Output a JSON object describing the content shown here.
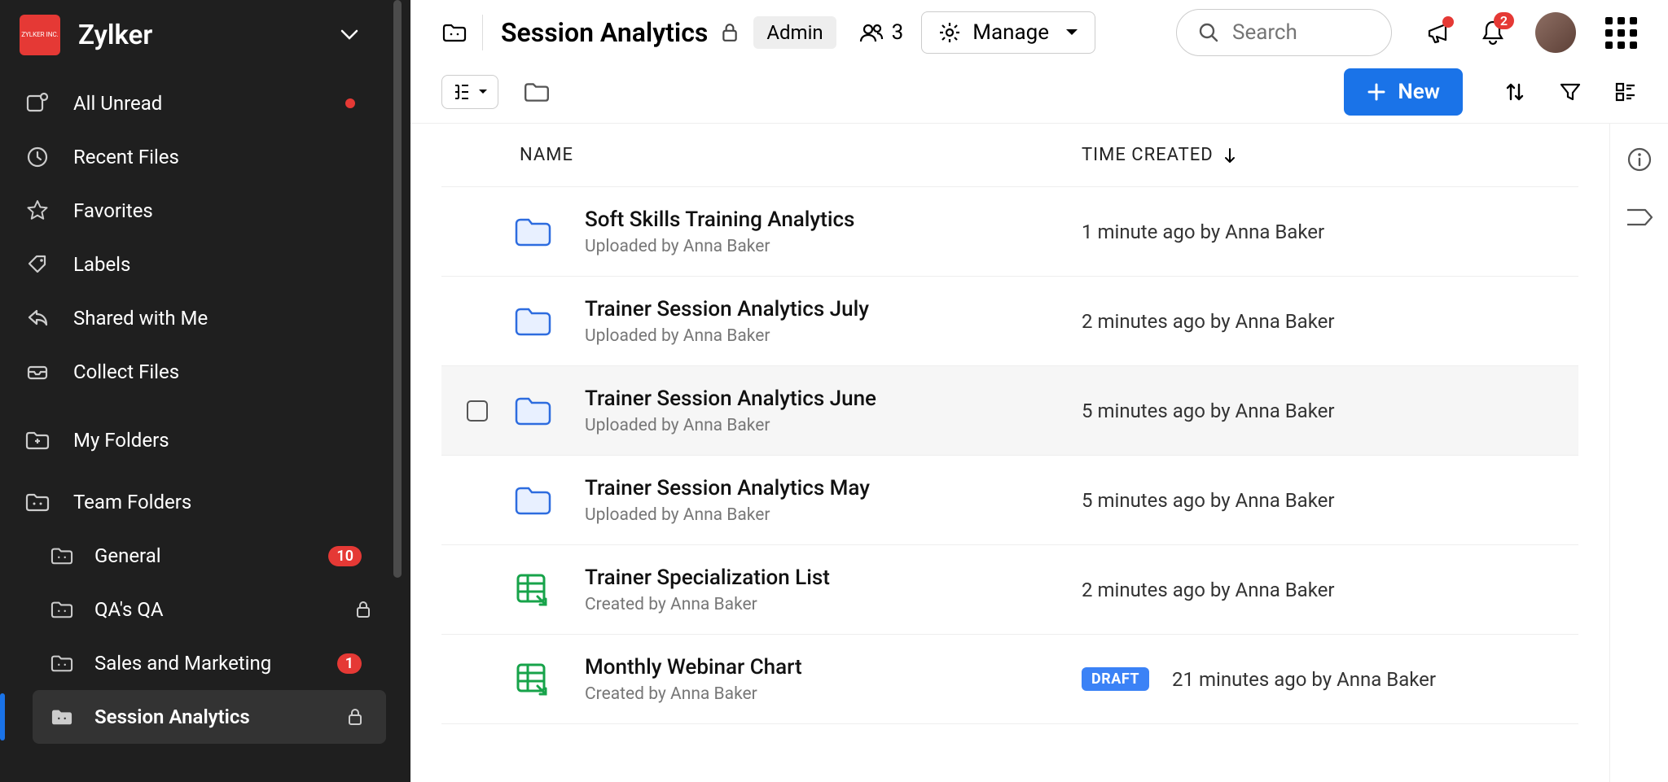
{
  "org": {
    "name": "Zylker",
    "logo_text": "ZYLKER INC."
  },
  "sidebar": {
    "items": [
      {
        "label": "All Unread",
        "icon": "mail-unread",
        "dot": true
      },
      {
        "label": "Recent Files",
        "icon": "clock"
      },
      {
        "label": "Favorites",
        "icon": "star"
      },
      {
        "label": "Labels",
        "icon": "tag"
      },
      {
        "label": "Shared with Me",
        "icon": "share-back"
      },
      {
        "label": "Collect Files",
        "icon": "inbox"
      }
    ],
    "myFolders": {
      "label": "My Folders"
    },
    "teamFolders": {
      "label": "Team Folders",
      "items": [
        {
          "label": "General",
          "badge": "10"
        },
        {
          "label": "QA's QA",
          "locked": true
        },
        {
          "label": "Sales and Marketing",
          "badge": "1"
        },
        {
          "label": "Session Analytics",
          "locked": true,
          "active": true
        }
      ]
    }
  },
  "header": {
    "title": "Session Analytics",
    "role": "Admin",
    "memberCount": "3",
    "manageLabel": "Manage",
    "searchPlaceholder": "Search",
    "notificationBadge": "2"
  },
  "toolbar": {
    "newLabel": "New"
  },
  "table": {
    "columns": {
      "name": "NAME",
      "time": "TIME CREATED"
    },
    "rows": [
      {
        "type": "folder",
        "title": "Soft Skills Training Analytics",
        "subtitle": "Uploaded by Anna Baker",
        "time": "1 minute ago by Anna Baker"
      },
      {
        "type": "folder",
        "title": "Trainer Session Analytics July",
        "subtitle": "Uploaded by Anna Baker",
        "time": "2 minutes ago by Anna Baker"
      },
      {
        "type": "folder",
        "title": "Trainer Session Analytics June",
        "subtitle": "Uploaded by Anna Baker",
        "time": "5 minutes ago by Anna Baker",
        "hovered": true
      },
      {
        "type": "folder",
        "title": "Trainer Session Analytics May",
        "subtitle": "Uploaded by Anna Baker",
        "time": "5 minutes ago by Anna Baker"
      },
      {
        "type": "sheet",
        "title": "Trainer Specialization List",
        "subtitle": "Created by Anna Baker",
        "time": "2 minutes ago by Anna Baker"
      },
      {
        "type": "sheet",
        "title": "Monthly Webinar Chart",
        "subtitle": "Created by Anna Baker",
        "time": "21 minutes ago by Anna Baker",
        "draft": "DRAFT"
      }
    ]
  }
}
